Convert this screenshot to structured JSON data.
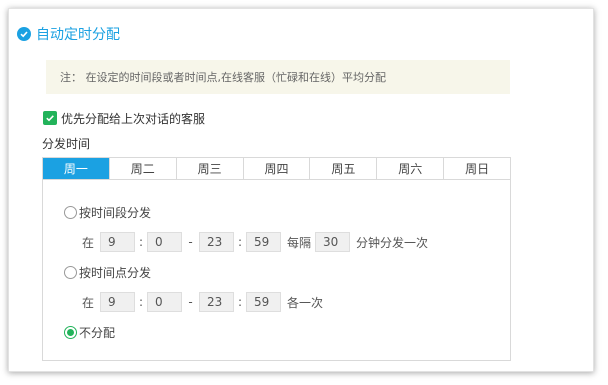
{
  "header": {
    "title": "自动定时分配"
  },
  "note": {
    "text": "注：  在设定的时间段或者时间点,在线客服（忙碌和在线）平均分配"
  },
  "priority": {
    "label": "优先分配给上次对话的客服",
    "checked": true
  },
  "distribution": {
    "label": "分发时间",
    "tabs": [
      "周一",
      "周二",
      "周三",
      "周四",
      "周五",
      "周六",
      "周日"
    ],
    "active_tab": "周一"
  },
  "options": {
    "by_period": {
      "label": "按时间段分发",
      "prefix": "在",
      "start_hour": "9",
      "start_min": "0",
      "end_hour": "23",
      "end_min": "59",
      "every_label": "每隔",
      "interval": "30",
      "suffix": "分钟分发一次"
    },
    "by_point": {
      "label": "按时间点分发",
      "prefix": "在",
      "start_hour": "9",
      "start_min": "0",
      "end_hour": "23",
      "end_min": "59",
      "suffix": "各一次"
    },
    "none": {
      "label": "不分配",
      "selected": true
    }
  },
  "colors": {
    "accent": "#1ba1e2",
    "check": "#22b35a",
    "note_bg": "#f7f6ea"
  }
}
